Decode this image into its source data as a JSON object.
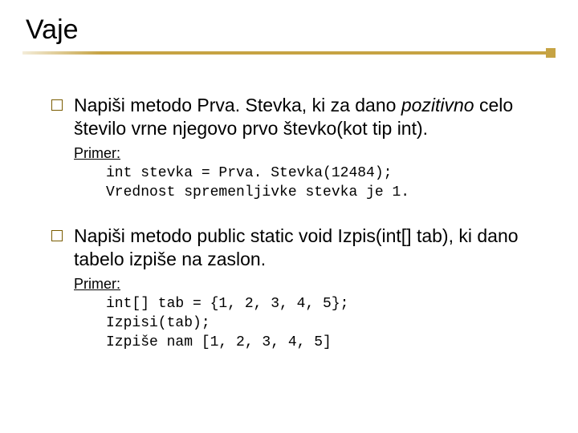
{
  "title": "Vaje",
  "items": [
    {
      "text_pre": "Napiši metodo Prva. Stevka, ki za dano ",
      "text_italic": "pozitivno",
      "text_post": " celo število vrne njegovo prvo števko(kot tip int).",
      "example_label": "Primer:",
      "code": "int stevka = Prva. Stevka(12484);\nVrednost spremenljivke stevka je 1."
    },
    {
      "text_pre": "Napiši metodo public static void Izpis(int[] tab), ki dano tabelo izpiše na zaslon.",
      "text_italic": "",
      "text_post": "",
      "example_label": "Primer:",
      "code": "int[] tab = {1, 2, 3, 4, 5};\nIzpisi(tab);\nIzpiše nam [1, 2, 3, 4, 5]"
    }
  ]
}
